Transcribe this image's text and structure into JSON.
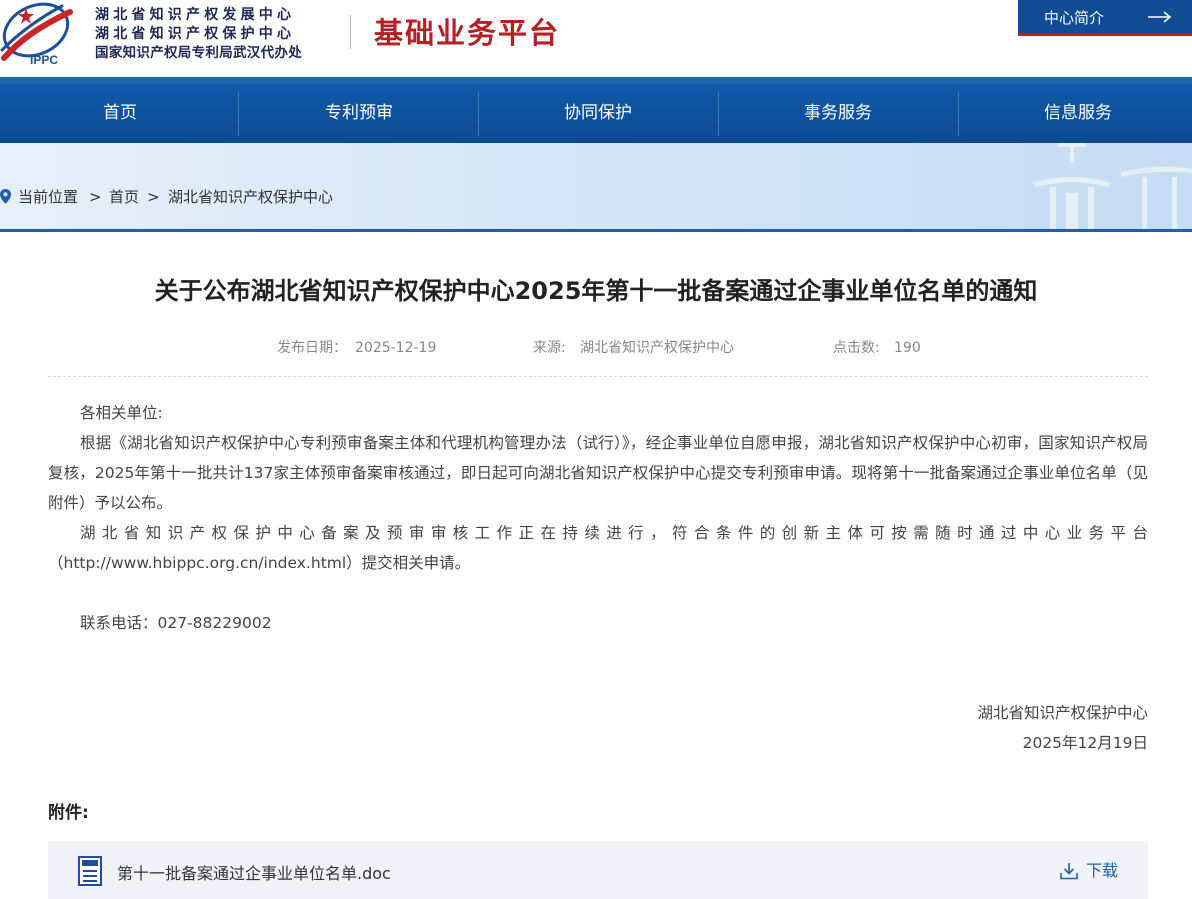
{
  "header": {
    "logo_text": "IPPC",
    "org_line1": "湖北省知识产权发展中心",
    "org_line2": "湖北省知识产权保护中心",
    "org_line3": "国家知识产权局专利局武汉代办处",
    "platform_title": "基础业务平台",
    "intro_label": "中心简介",
    "intro_arrow": "⟶"
  },
  "nav": {
    "items": [
      {
        "label": "首页"
      },
      {
        "label": "专利预审"
      },
      {
        "label": "协同保护"
      },
      {
        "label": "事务服务"
      },
      {
        "label": "信息服务"
      }
    ]
  },
  "breadcrumb": {
    "prefix": "当前位置",
    "sep": ">",
    "home": "首页",
    "current": "湖北省知识产权保护中心"
  },
  "article": {
    "title": "关于公布湖北省知识产权保护中心2025年第十一批备案通过企事业单位名单的通知",
    "meta": {
      "date_label": "发布日期：",
      "date": "2025-12-19",
      "source_label": "来源:",
      "source": "湖北省知识产权保护中心",
      "clicks_label": "点击数:",
      "clicks": "190"
    },
    "greeting": "各相关单位:",
    "para1": "根据《湖北省知识产权保护中心专利预审备案主体和代理机构管理办法（试行）》，经企事业单位自愿申报，湖北省知识产权保护中心初审，国家知识产权局复核，2025年第十一批共计137家主体预审备案审核通过，即日起可向湖北省知识产权保护中心提交专利预审申请。现将第十一批备案通过企事业单位名单（见附件）予以公布。",
    "para2a": "湖北省知识产权保护中心备案及预审审核工作正在持续进行，符合条件的创新主体可按需随时通过中心业务平台",
    "para2b": "（http://www.hbippc.org.cn/index.html）提交相关申请。",
    "contact": "联系电话：027-88229002",
    "sign_org": "湖北省知识产权保护中心",
    "sign_date": "2025年12月19日"
  },
  "attachment": {
    "title": "附件:",
    "file_name": "第十一批备案通过企事业单位名单.doc",
    "download_label": "下载"
  },
  "colors": {
    "brand_blue": "#0f4c93",
    "brand_red": "#b52025",
    "link_blue": "#1f5fa9"
  }
}
